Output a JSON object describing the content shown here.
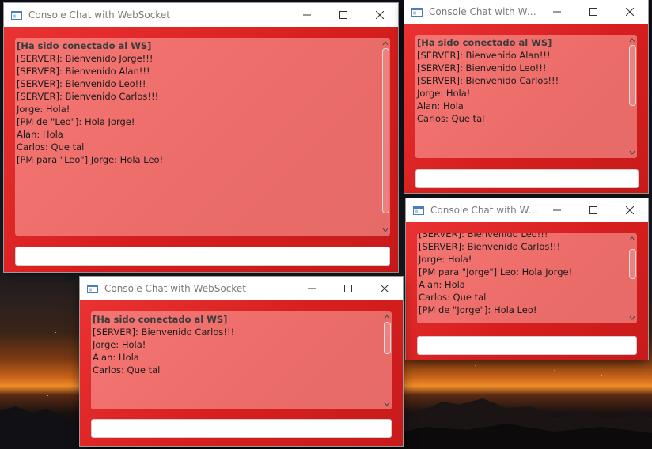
{
  "windows": [
    {
      "title": "Console Chat with WebSocket",
      "lines": [
        "[Ha sido conectado al WS]",
        "[SERVER]: Bienvenido Jorge!!!",
        "[SERVER]: Bienvenido Alan!!!",
        "[SERVER]: Bienvenido Leo!!!",
        "[SERVER]: Bienvenido Carlos!!!",
        "Jorge: Hola!",
        "[PM de \"Leo\"]: Hola Jorge!",
        "Alan: Hola",
        "Carlos: Que tal",
        "[PM para \"Leo\"] Jorge: Hola Leo!"
      ],
      "input_value": ""
    },
    {
      "title": "Console Chat with WebS...",
      "lines": [
        "[Ha sido conectado al WS]",
        "[SERVER]: Bienvenido Alan!!!",
        "[SERVER]: Bienvenido Leo!!!",
        "[SERVER]: Bienvenido Carlos!!!",
        "Jorge: Hola!",
        "Alan: Hola",
        "Carlos: Que tal"
      ],
      "input_value": ""
    },
    {
      "title": "Console Chat with Web...",
      "lines": [
        "[SERVER]: Bienvenido Leo!!!",
        "[SERVER]: Bienvenido Carlos!!!",
        "Jorge: Hola!",
        "[PM para \"Jorge\"] Leo: Hola Jorge!",
        "Alan: Hola",
        "Carlos: Que tal",
        "[PM de \"Jorge\"]: Hola Leo!"
      ],
      "input_value": ""
    },
    {
      "title": "Console Chat with WebSocket",
      "lines": [
        "[Ha sido conectado al WS]",
        "[SERVER]: Bienvenido Carlos!!!",
        "Jorge: Hola!",
        "Alan: Hola",
        "Carlos: Que tal"
      ],
      "input_value": ""
    }
  ],
  "icons": {
    "app": "window-app-icon",
    "minimize": "minimize-icon",
    "maximize": "maximize-icon",
    "close": "close-icon"
  },
  "colors": {
    "window_body": "#d61e1e",
    "chat_area": "#e87a7a",
    "bold_text": "#3b3b3b"
  }
}
